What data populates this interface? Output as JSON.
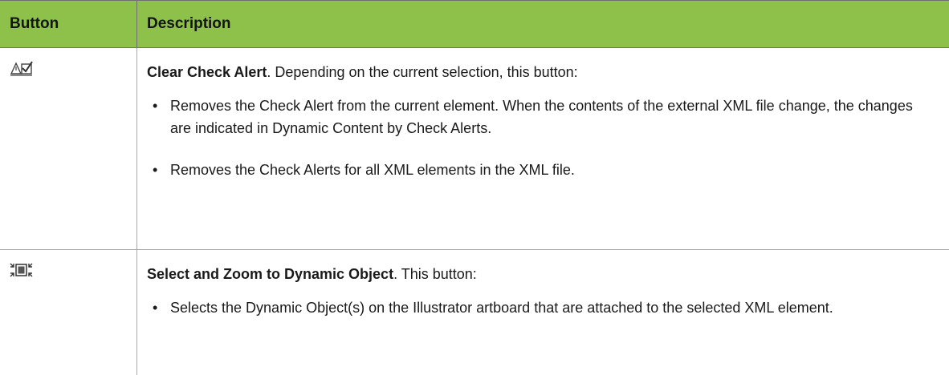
{
  "table": {
    "headers": {
      "button": "Button",
      "description": "Description"
    },
    "rows": [
      {
        "icon": "clear-check-alert-icon",
        "title": "Clear Check Alert",
        "intro": ". Depending on the current selection, this button:",
        "bullets": [
          "Removes the Check Alert from the current element. When the contents of the external XML file change, the changes are indicated in Dynamic Content by Check Alerts.",
          "Removes the Check Alerts for all XML elements in the XML file."
        ]
      },
      {
        "icon": "select-zoom-icon",
        "title": "Select and Zoom to Dynamic Object",
        "intro": ". This button:",
        "bullets": [
          "Selects the Dynamic Object(s) on the Illustrator artboard that are attached to the selected XML element."
        ]
      }
    ]
  }
}
